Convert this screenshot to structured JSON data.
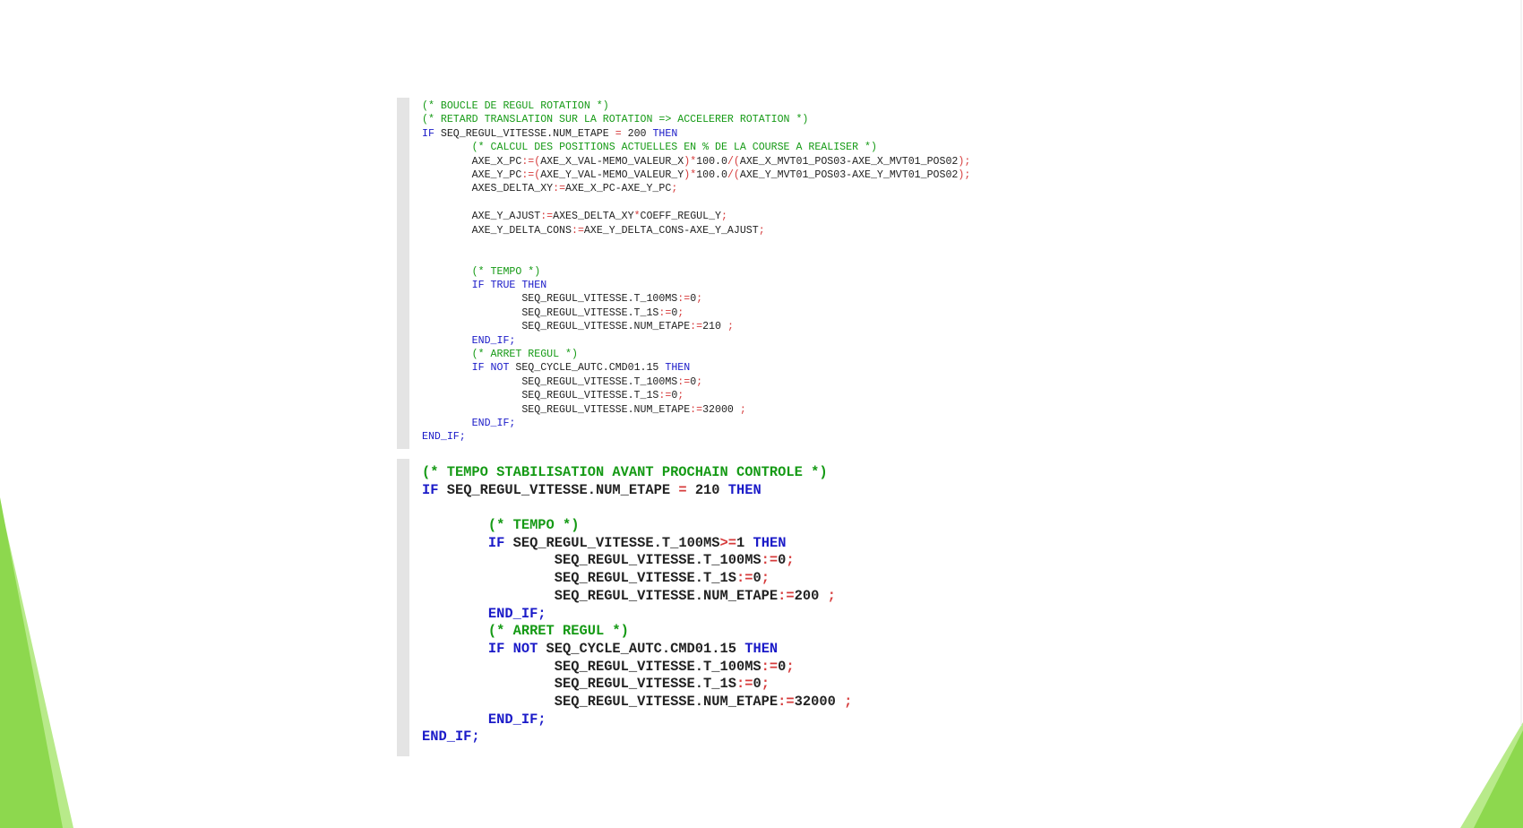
{
  "theme": {
    "accent": "#8dd84e",
    "accent_light": "#b8ea8a",
    "keyword": "#1a1ac8",
    "comment": "#159a15",
    "operator": "#d63b3b",
    "gutter": "#e4e4e4"
  },
  "panels": [
    {
      "lines": [
        [
          [
            "cm",
            "(* BOUCLE DE REGUL ROTATION *)"
          ]
        ],
        [
          [
            "cm",
            "(* RETARD TRANSLATION SUR LA ROTATION => ACCELERER ROTATION *)"
          ]
        ],
        [
          [
            "kw",
            "IF "
          ],
          [
            "id",
            "SEQ_REGUL_VITESSE.NUM_ETAPE "
          ],
          [
            "op",
            "="
          ],
          [
            "id",
            " 200 "
          ],
          [
            "kw",
            "THEN"
          ]
        ],
        [
          [
            "id",
            "        "
          ],
          [
            "cm",
            "(* CALCUL DES POSITIONS ACTUELLES EN % DE LA COURSE A REALISER *)"
          ]
        ],
        [
          [
            "id",
            "        AXE_X_PC"
          ],
          [
            "op",
            ":=("
          ],
          [
            "id",
            "AXE_X_VAL-MEMO_VALEUR_X"
          ],
          [
            "op",
            ")*"
          ],
          [
            "id",
            "100.0"
          ],
          [
            "op",
            "/("
          ],
          [
            "id",
            "AXE_X_MVT01_POS03-AXE_X_MVT01_POS02"
          ],
          [
            "op",
            ");"
          ]
        ],
        [
          [
            "id",
            "        AXE_Y_PC"
          ],
          [
            "op",
            ":=("
          ],
          [
            "id",
            "AXE_Y_VAL-MEMO_VALEUR_Y"
          ],
          [
            "op",
            ")*"
          ],
          [
            "id",
            "100.0"
          ],
          [
            "op",
            "/("
          ],
          [
            "id",
            "AXE_Y_MVT01_POS03-AXE_Y_MVT01_POS02"
          ],
          [
            "op",
            ");"
          ]
        ],
        [
          [
            "id",
            "        AXES_DELTA_XY"
          ],
          [
            "op",
            ":="
          ],
          [
            "id",
            "AXE_X_PC-AXE_Y_PC"
          ],
          [
            "op",
            ";"
          ]
        ],
        [
          [
            "id",
            ""
          ]
        ],
        [
          [
            "id",
            "        AXE_Y_AJUST"
          ],
          [
            "op",
            ":="
          ],
          [
            "id",
            "AXES_DELTA_XY"
          ],
          [
            "op",
            "*"
          ],
          [
            "id",
            "COEFF_REGUL_Y"
          ],
          [
            "op",
            ";"
          ]
        ],
        [
          [
            "id",
            "        AXE_Y_DELTA_CONS"
          ],
          [
            "op",
            ":="
          ],
          [
            "id",
            "AXE_Y_DELTA_CONS-AXE_Y_AJUST"
          ],
          [
            "op",
            ";"
          ]
        ],
        [
          [
            "id",
            ""
          ]
        ],
        [
          [
            "id",
            ""
          ]
        ],
        [
          [
            "id",
            "        "
          ],
          [
            "cm",
            "(* TEMPO *)"
          ]
        ],
        [
          [
            "id",
            "        "
          ],
          [
            "kw",
            "IF TRUE THEN"
          ]
        ],
        [
          [
            "id",
            "                SEQ_REGUL_VITESSE.T_100MS"
          ],
          [
            "op",
            ":="
          ],
          [
            "id",
            "0"
          ],
          [
            "op",
            ";"
          ]
        ],
        [
          [
            "id",
            "                SEQ_REGUL_VITESSE.T_1S"
          ],
          [
            "op",
            ":="
          ],
          [
            "id",
            "0"
          ],
          [
            "op",
            ";"
          ]
        ],
        [
          [
            "id",
            "                SEQ_REGUL_VITESSE.NUM_ETAPE"
          ],
          [
            "op",
            ":="
          ],
          [
            "id",
            "210 "
          ],
          [
            "op",
            ";"
          ]
        ],
        [
          [
            "id",
            "        "
          ],
          [
            "kw",
            "END_IF;"
          ]
        ],
        [
          [
            "id",
            "        "
          ],
          [
            "cm",
            "(* ARRET REGUL *)"
          ]
        ],
        [
          [
            "id",
            "        "
          ],
          [
            "kw",
            "IF NOT "
          ],
          [
            "id",
            "SEQ_CYCLE_AUTC.CMD01.15 "
          ],
          [
            "kw",
            "THEN"
          ]
        ],
        [
          [
            "id",
            "                SEQ_REGUL_VITESSE.T_100MS"
          ],
          [
            "op",
            ":="
          ],
          [
            "id",
            "0"
          ],
          [
            "op",
            ";"
          ]
        ],
        [
          [
            "id",
            "                SEQ_REGUL_VITESSE.T_1S"
          ],
          [
            "op",
            ":="
          ],
          [
            "id",
            "0"
          ],
          [
            "op",
            ";"
          ]
        ],
        [
          [
            "id",
            "                SEQ_REGUL_VITESSE.NUM_ETAPE"
          ],
          [
            "op",
            ":="
          ],
          [
            "id",
            "32000 "
          ],
          [
            "op",
            ";"
          ]
        ],
        [
          [
            "id",
            "        "
          ],
          [
            "kw",
            "END_IF;"
          ]
        ],
        [
          [
            "kw",
            "END_IF;"
          ]
        ]
      ]
    },
    {
      "lines": [
        [
          [
            "cm",
            "(* TEMPO STABILISATION AVANT PROCHAIN CONTROLE *)"
          ]
        ],
        [
          [
            "kw",
            "IF "
          ],
          [
            "id",
            "SEQ_REGUL_VITESSE.NUM_ETAPE "
          ],
          [
            "op",
            "="
          ],
          [
            "id",
            " 210 "
          ],
          [
            "kw",
            "THEN"
          ]
        ],
        [
          [
            "id",
            ""
          ]
        ],
        [
          [
            "id",
            "        "
          ],
          [
            "cm",
            "(* TEMPO *)"
          ]
        ],
        [
          [
            "id",
            "        "
          ],
          [
            "kw",
            "IF "
          ],
          [
            "id",
            "SEQ_REGUL_VITESSE.T_100MS"
          ],
          [
            "op",
            ">="
          ],
          [
            "id",
            "1 "
          ],
          [
            "kw",
            "THEN"
          ]
        ],
        [
          [
            "id",
            "                SEQ_REGUL_VITESSE.T_100MS"
          ],
          [
            "op",
            ":="
          ],
          [
            "id",
            "0"
          ],
          [
            "op",
            ";"
          ]
        ],
        [
          [
            "id",
            "                SEQ_REGUL_VITESSE.T_1S"
          ],
          [
            "op",
            ":="
          ],
          [
            "id",
            "0"
          ],
          [
            "op",
            ";"
          ]
        ],
        [
          [
            "id",
            "                SEQ_REGUL_VITESSE.NUM_ETAPE"
          ],
          [
            "op",
            ":="
          ],
          [
            "id",
            "200 "
          ],
          [
            "op",
            ";"
          ]
        ],
        [
          [
            "id",
            "        "
          ],
          [
            "kw",
            "END_IF;"
          ]
        ],
        [
          [
            "id",
            "        "
          ],
          [
            "cm",
            "(* ARRET REGUL *)"
          ]
        ],
        [
          [
            "id",
            "        "
          ],
          [
            "kw",
            "IF NOT "
          ],
          [
            "id",
            "SEQ_CYCLE_AUTC.CMD01.15 "
          ],
          [
            "kw",
            "THEN"
          ]
        ],
        [
          [
            "id",
            "                SEQ_REGUL_VITESSE.T_100MS"
          ],
          [
            "op",
            ":="
          ],
          [
            "id",
            "0"
          ],
          [
            "op",
            ";"
          ]
        ],
        [
          [
            "id",
            "                SEQ_REGUL_VITESSE.T_1S"
          ],
          [
            "op",
            ":="
          ],
          [
            "id",
            "0"
          ],
          [
            "op",
            ";"
          ]
        ],
        [
          [
            "id",
            "                SEQ_REGUL_VITESSE.NUM_ETAPE"
          ],
          [
            "op",
            ":="
          ],
          [
            "id",
            "32000 "
          ],
          [
            "op",
            ";"
          ]
        ],
        [
          [
            "id",
            "        "
          ],
          [
            "kw",
            "END_IF;"
          ]
        ],
        [
          [
            "kw",
            "END_IF;"
          ]
        ]
      ]
    }
  ]
}
